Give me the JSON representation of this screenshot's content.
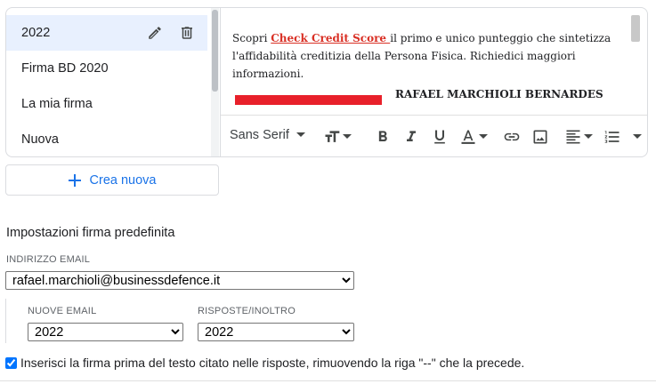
{
  "signatures": {
    "items": [
      {
        "label": "2022"
      },
      {
        "label": "Firma BD 2020"
      },
      {
        "label": "La mia firma"
      },
      {
        "label": "Nuova"
      }
    ]
  },
  "editor": {
    "text_before": "Scopri ",
    "link_text": "Check Credit Score ",
    "text_after": "il primo e unico punteggio che sintetizza l'affidabilità creditizia della Persona Fisica. Richiedici maggiori informazioni.",
    "signature_name": "RAFAEL MARCHIOLI BERNARDES",
    "accent_color": "#e8202a"
  },
  "toolbar": {
    "font_family": "Sans Serif",
    "icons": [
      "text-size-icon",
      "bold-icon",
      "italic-icon",
      "underline-icon",
      "text-color-icon",
      "link-icon",
      "image-icon",
      "align-icon",
      "numbered-list-icon",
      "more-icon"
    ]
  },
  "create_button": {
    "label": "Crea nuova",
    "color": "#1a73e8"
  },
  "defaults": {
    "title": "Impostazioni firma predefinita",
    "email_label": "INDIRIZZO EMAIL",
    "email_value": "rafael.marchioli@businessdefence.it",
    "new_email_label": "NUOVE EMAIL",
    "new_email_value": "2022",
    "reply_label": "RISPOSTE/INOLTRO",
    "reply_value": "2022"
  },
  "insert_option": {
    "label": "Inserisci la firma prima del testo citato nelle risposte, rimuovendo la riga \"--\" che la precede.",
    "checked": true
  }
}
